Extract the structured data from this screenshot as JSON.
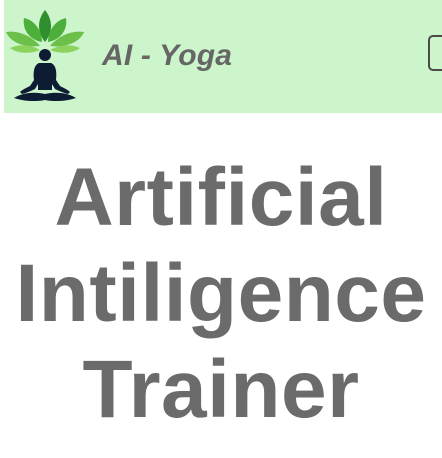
{
  "navbar": {
    "brand_name": "AI - Yoga",
    "logo_icon": "yoga-meditation-lotus-icon",
    "toggle_icon": "navbar-toggle-icon",
    "background_color": "#ccf5cc"
  },
  "hero": {
    "line1": "Artificial",
    "line2": "Intiligence",
    "line3": "Trainer",
    "text_color": "#6b6b6b"
  }
}
